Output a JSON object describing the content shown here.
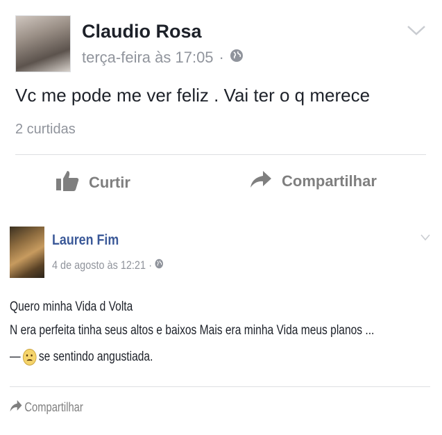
{
  "post1": {
    "author": "Claudio Rosa",
    "timestamp": "terça-feira às 17:05",
    "separator": "·",
    "privacy_icon": "globe-icon",
    "menu_icon": "chevron-down-icon",
    "text": "Vc me pode me ver feliz . Vai ter o q merece",
    "likes": "2 curtidas",
    "actions": {
      "like_label": "Curtir",
      "share_label": "Compartilhar"
    }
  },
  "post2": {
    "author": "Lauren Fim",
    "timestamp": "4 de agosto às 12:21",
    "separator": "·",
    "privacy_icon": "globe-icon",
    "menu_icon": "chevron-down-icon",
    "line1": "Quero minha Vida d Volta",
    "line2": "N era perfeita tinha seus altos e baixos Mais era minha Vida meus planos ...",
    "feeling_prefix": "—",
    "feeling": "se sentindo angustiada.",
    "share_label": "Compartilhar"
  },
  "colors": {
    "name_link": "#3b5998",
    "meta_gray": "#90949c",
    "divider": "#dddfe2",
    "action_gray": "#7f7f7f"
  }
}
